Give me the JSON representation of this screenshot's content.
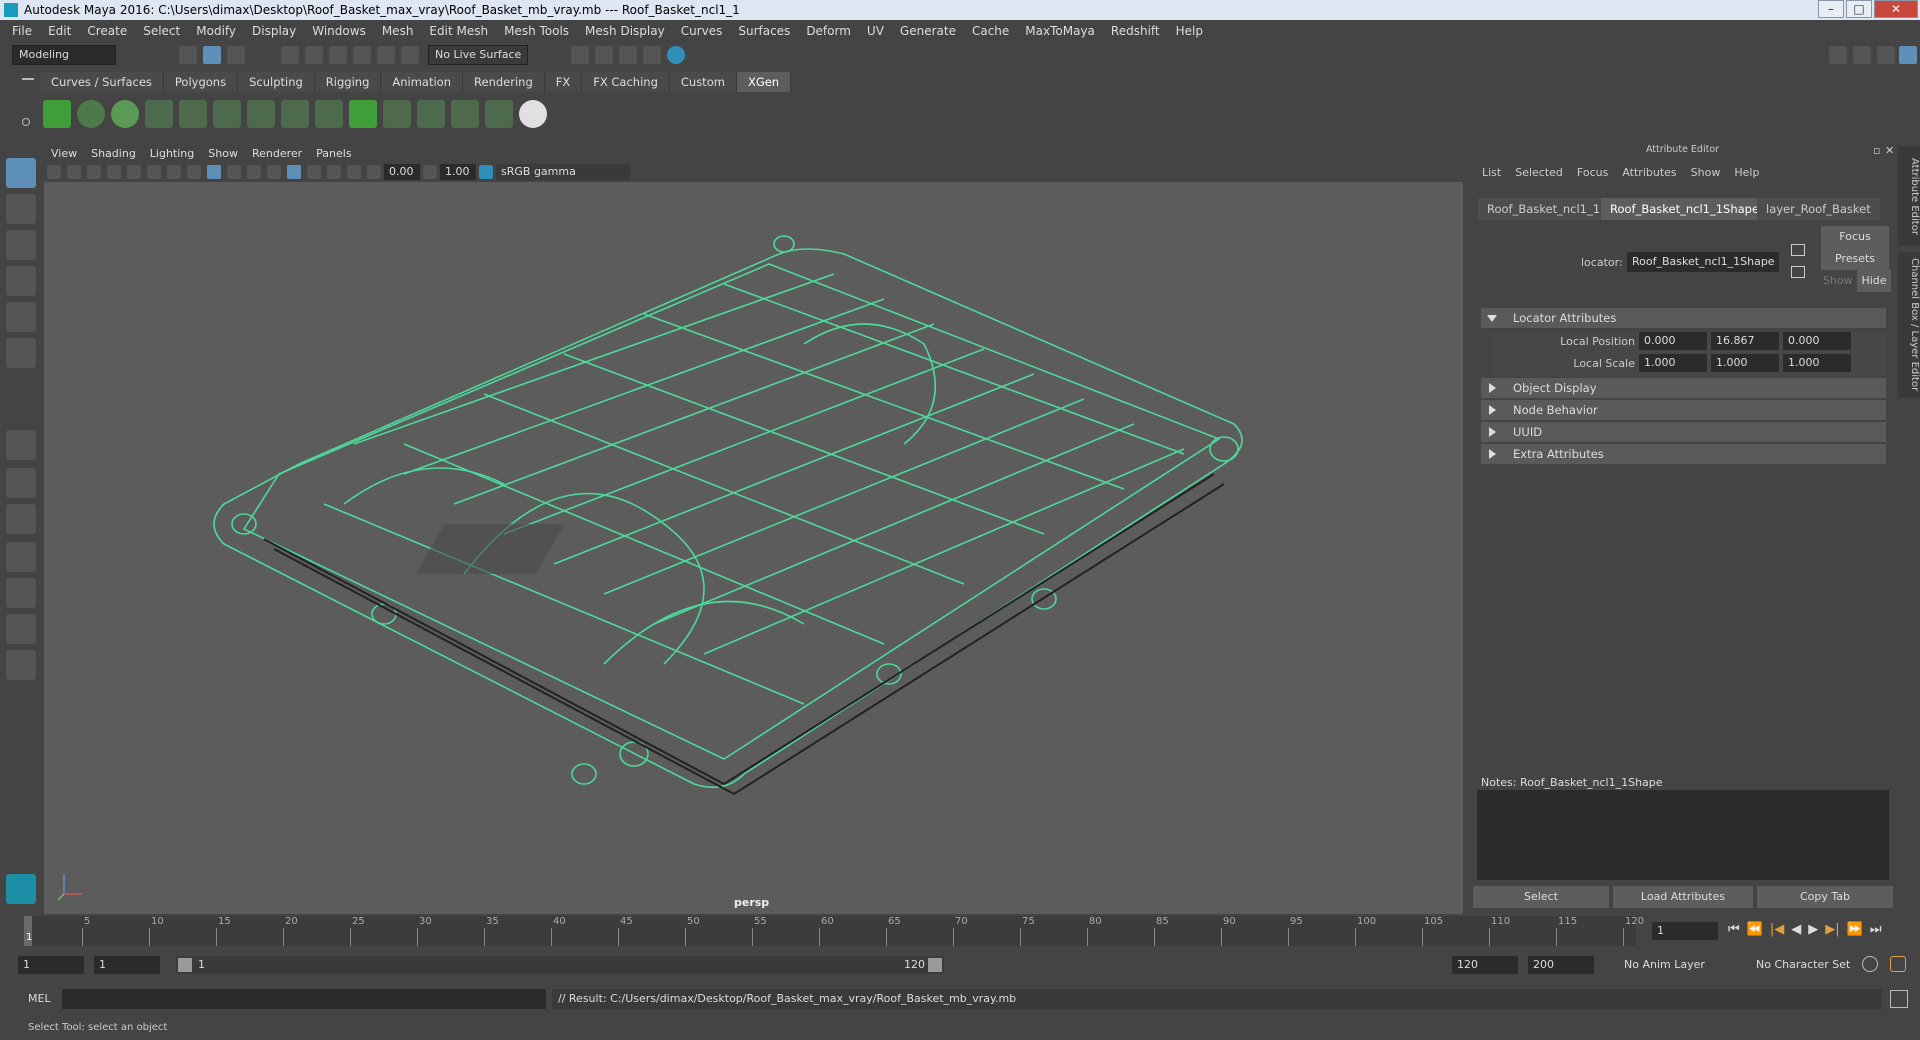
{
  "window": {
    "title": "Autodesk Maya 2016: C:\\Users\\dimax\\Desktop\\Roof_Basket_max_vray\\Roof_Basket_mb_vray.mb   ---   Roof_Basket_ncl1_1"
  },
  "menu": [
    "File",
    "Edit",
    "Create",
    "Select",
    "Modify",
    "Display",
    "Windows",
    "Mesh",
    "Edit Mesh",
    "Mesh Tools",
    "Mesh Display",
    "Curves",
    "Surfaces",
    "Deform",
    "UV",
    "Generate",
    "Cache",
    "MaxToMaya",
    "Redshift",
    "Help"
  ],
  "status": {
    "mode": "Modeling",
    "live_surface": "No Live Surface"
  },
  "shelf_tabs": [
    "Curves / Surfaces",
    "Polygons",
    "Sculpting",
    "Rigging",
    "Animation",
    "Rendering",
    "FX",
    "FX Caching",
    "Custom",
    "XGen"
  ],
  "shelf_active": "XGen",
  "viewport": {
    "menu": [
      "View",
      "Shading",
      "Lighting",
      "Show",
      "Renderer",
      "Panels"
    ],
    "exposure": "0.00",
    "gamma": "1.00",
    "color_space": "sRGB gamma",
    "camera_label": "persp",
    "wire_color": "#4dd99a"
  },
  "attribute_editor": {
    "header": "Attribute Editor",
    "menu": [
      "List",
      "Selected",
      "Focus",
      "Attributes",
      "Show",
      "Help"
    ],
    "tabs": [
      "Roof_Basket_ncl1_1",
      "Roof_Basket_ncl1_1Shape",
      "layer_Roof_Basket"
    ],
    "active_tab": "Roof_Basket_ncl1_1Shape",
    "locator_label": "locator:",
    "locator_value": "Roof_Basket_ncl1_1Shape",
    "buttons": {
      "focus": "Focus",
      "presets": "Presets",
      "show": "Show",
      "hide": "Hide"
    },
    "sections": [
      "Locator Attributes",
      "Object Display",
      "Node Behavior",
      "UUID",
      "Extra Attributes"
    ],
    "local_position_label": "Local Position",
    "local_position": [
      "0.000",
      "16.867",
      "0.000"
    ],
    "local_scale_label": "Local Scale",
    "local_scale": [
      "1.000",
      "1.000",
      "1.000"
    ],
    "notes_label": "Notes:  Roof_Basket_ncl1_1Shape",
    "bottom_buttons": [
      "Select",
      "Load Attributes",
      "Copy Tab"
    ],
    "side_tabs": [
      "Attribute Editor",
      "Channel Box / Layer Editor"
    ]
  },
  "timeline": {
    "ticks": [
      "5",
      "10",
      "15",
      "20",
      "25",
      "30",
      "35",
      "40",
      "45",
      "50",
      "55",
      "60",
      "65",
      "70",
      "75",
      "80",
      "85",
      "90",
      "95",
      "100",
      "105",
      "110",
      "115",
      "120"
    ],
    "start_label": "1",
    "current_frame": "1"
  },
  "range": {
    "start": "1",
    "start2": "1",
    "slider_start": "1",
    "slider_end": "120",
    "end": "120",
    "end2": "200",
    "anim_layer": "No Anim Layer",
    "char_set": "No Character Set"
  },
  "command": {
    "lang": "MEL",
    "result": "// Result: C:/Users/dimax/Desktop/Roof_Basket_max_vray/Roof_Basket_mb_vray.mb"
  },
  "help": "Select Tool: select an object"
}
